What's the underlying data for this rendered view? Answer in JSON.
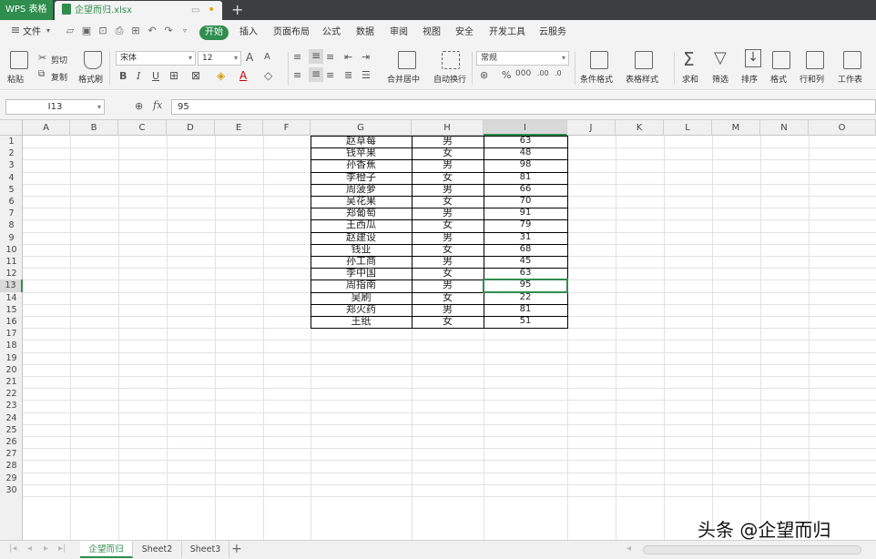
{
  "titlebar": {
    "app_tab": "WPS 表格",
    "doc_tab": "企望而归.xlsx",
    "new_tab": "+"
  },
  "menubar": {
    "file": "文件",
    "start": "开始",
    "items": [
      "插入",
      "页面布局",
      "公式",
      "数据",
      "审阅",
      "视图",
      "安全",
      "开发工具",
      "云服务"
    ]
  },
  "ribbon": {
    "paste": "粘贴",
    "cut": "剪切",
    "copy": "复制",
    "format_painter": "格式刷",
    "font_name": "宋体",
    "font_size": "12",
    "merge_center": "合并居中",
    "wrap_text": "自动换行",
    "number_format": "常规",
    "conditional_format": "条件格式",
    "table_style": "表格样式",
    "sum": "求和",
    "filter": "筛选",
    "sort": "排序",
    "format": "格式",
    "row_col": "行和列",
    "worksheet": "工作表"
  },
  "formula_bar": {
    "name_box": "I13",
    "fx": "fx",
    "value": "95"
  },
  "columns": [
    "A",
    "B",
    "C",
    "D",
    "E",
    "F",
    "G",
    "H",
    "I",
    "J",
    "K",
    "L",
    "M",
    "N",
    "O"
  ],
  "rows": [
    "1",
    "2",
    "3",
    "4",
    "5",
    "6",
    "7",
    "8",
    "9",
    "10",
    "11",
    "12",
    "13",
    "14",
    "15",
    "16",
    "17",
    "18",
    "19",
    "20",
    "21",
    "22",
    "23",
    "24",
    "25",
    "26",
    "27",
    "28",
    "29",
    "30"
  ],
  "table": [
    [
      "赵草莓",
      "男",
      "63"
    ],
    [
      "钱苹果",
      "女",
      "48"
    ],
    [
      "孙香蕉",
      "男",
      "98"
    ],
    [
      "李橙子",
      "女",
      "81"
    ],
    [
      "周菠萝",
      "男",
      "66"
    ],
    [
      "吴花果",
      "女",
      "70"
    ],
    [
      "郑葡萄",
      "男",
      "91"
    ],
    [
      "王西瓜",
      "女",
      "79"
    ],
    [
      "赵建设",
      "男",
      "31"
    ],
    [
      "钱业",
      "女",
      "68"
    ],
    [
      "孙工商",
      "男",
      "45"
    ],
    [
      "李中国",
      "女",
      "63"
    ],
    [
      "周指南",
      "男",
      "95"
    ],
    [
      "吴刷",
      "女",
      "22"
    ],
    [
      "郑火药",
      "男",
      "81"
    ],
    [
      "王纸",
      "女",
      "51"
    ]
  ],
  "sheets": [
    "企望而归",
    "Sheet2",
    "Sheet3"
  ],
  "active_sheet": "企望而归",
  "watermark": "头条 @企望而归",
  "colors": {
    "accent": "#2f8d4e",
    "titlebar": "#3c3f41"
  }
}
